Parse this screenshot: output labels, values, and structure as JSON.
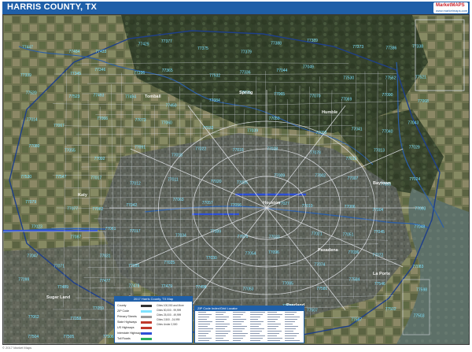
{
  "header": {
    "title": "HARRIS COUNTY, TX",
    "logo_word": "MarketMAPS",
    "logo_sub": "www.marketmaps.com"
  },
  "map": {
    "zip_labels": [
      "77447",
      "77484",
      "77433",
      "77429",
      "77377",
      "77375",
      "77379",
      "77388",
      "77389",
      "77373",
      "77386",
      "77338",
      "77339",
      "77345",
      "77346",
      "77396",
      "77365",
      "77532",
      "77336",
      "77044",
      "77049",
      "77530",
      "77562",
      "77521",
      "77520",
      "77523",
      "77493",
      "77494",
      "77450",
      "77084",
      "77095",
      "77065",
      "77070",
      "77069",
      "77090",
      "77068",
      "77014",
      "77067",
      "77066",
      "77073",
      "77060",
      "77032",
      "77039",
      "77050",
      "77093",
      "77041",
      "77040",
      "77043",
      "77080",
      "77055",
      "77092",
      "77091",
      "77018",
      "77022",
      "77016",
      "77028",
      "77078",
      "77015",
      "77013",
      "77029",
      "77530",
      "77547",
      "77017",
      "77012",
      "77011",
      "77020",
      "77026",
      "77009",
      "77002",
      "77007",
      "77008",
      "77024",
      "77079",
      "77077",
      "77082",
      "77042",
      "77063",
      "77057",
      "77056",
      "77027",
      "77019",
      "77006",
      "77004",
      "77003",
      "77023",
      "77087",
      "77061",
      "77017",
      "77034",
      "77089",
      "77075",
      "77033",
      "77021",
      "77051",
      "77045",
      "77048",
      "77047",
      "77071",
      "77031",
      "77035",
      "77025",
      "77030",
      "77054",
      "77096",
      "77074",
      "77036",
      "77072",
      "77083",
      "77099",
      "77489",
      "77477",
      "77478",
      "77479",
      "77498",
      "77053",
      "77085",
      "77581",
      "77584",
      "77546",
      "77598",
      "77062",
      "77058",
      "77059",
      "77573",
      "77565",
      "77586",
      "77571",
      "77536",
      "77507",
      "77587",
      "77502",
      "77503",
      "77504",
      "77505",
      "77506"
    ],
    "city_labels": [
      "Houston",
      "Pasadena",
      "Baytown",
      "Katy",
      "Humble",
      "Tomball",
      "Spring",
      "Sugar Land",
      "Pearland",
      "La Porte"
    ],
    "colors": {
      "title_bar": "#1f5fa8",
      "zip_text": "#7fe3ff",
      "water": "#2b5ea8",
      "roads": "#cfd4dc",
      "highway": "#2d4fd6",
      "land_dark": "#33402c",
      "land_light": "#7c7d5c"
    }
  },
  "legend": {
    "title": "2017 Harris County, TX Map",
    "rows": [
      {
        "label": "County",
        "swatch": "#333333"
      },
      {
        "label": "ZIP Code",
        "swatch": "#7fe3ff"
      },
      {
        "label": "Primary Streets",
        "swatch": "#999999"
      },
      {
        "label": "State Highways",
        "swatch": "#c0392b"
      },
      {
        "label": "US Highways",
        "swatch": "#c0392b"
      },
      {
        "label": "Interstate Highways",
        "swatch": "#2d4fd6"
      },
      {
        "label": "Toll Roads",
        "swatch": "#27ae60"
      }
    ],
    "right_rows": [
      "Cities 100,000 and More",
      "Cities 50,000 - 99,999",
      "Cities 25,000 - 49,999",
      "Cities 2,500 - 24,999",
      "Cities Under 2,500"
    ]
  },
  "index": {
    "title": "ZIP Code Index/Grid Locator"
  },
  "footer": {
    "text": "© 2017 Market Maps"
  }
}
